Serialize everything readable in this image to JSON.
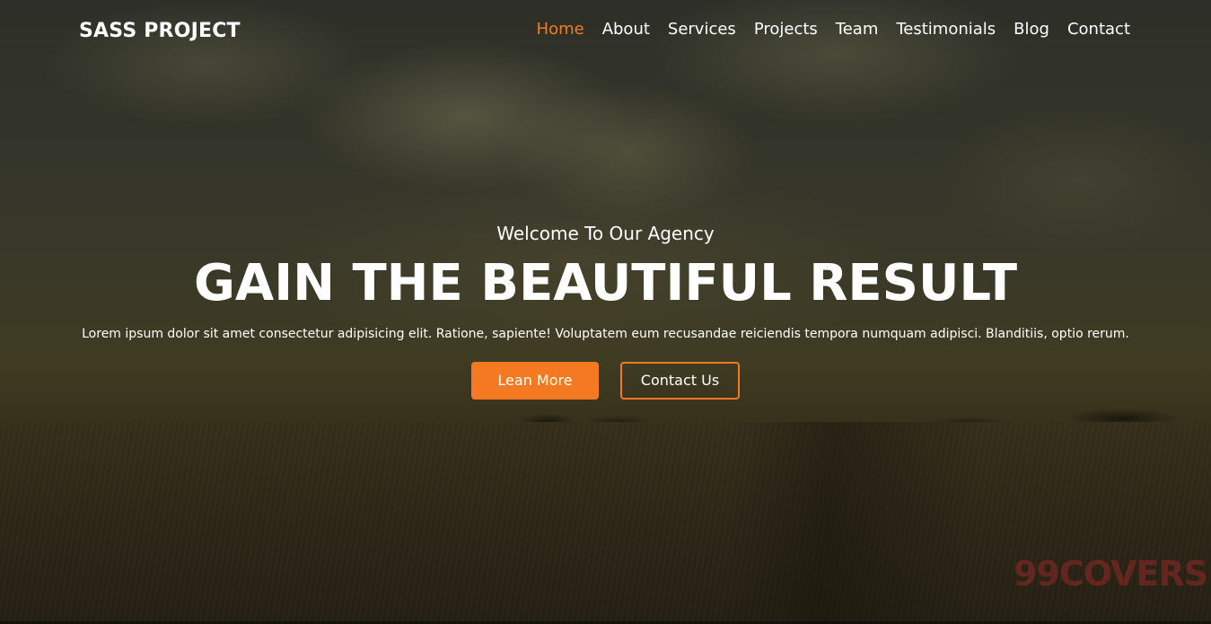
{
  "brand": "SASS PROJECT",
  "nav": {
    "items": [
      {
        "label": "Home",
        "active": true
      },
      {
        "label": "About"
      },
      {
        "label": "Services"
      },
      {
        "label": "Projects"
      },
      {
        "label": "Team"
      },
      {
        "label": "Testimonials"
      },
      {
        "label": "Blog"
      },
      {
        "label": "Contact"
      }
    ]
  },
  "hero": {
    "subtitle": "Welcome To Our Agency",
    "headline": "GAIN THE BEAUTIFUL RESULT",
    "lead": "Lorem ipsum dolor sit amet consectetur adipisicing elit. Ratione, sapiente! Voluptatem eum recusandae reiciendis tempora numquam adipisci. Blanditiis, optio rerum.",
    "primary_button": "Lean More",
    "secondary_button": "Contact Us"
  },
  "watermark": "99COVERS",
  "colors": {
    "accent": "#f47920",
    "text": "#ffffff"
  }
}
